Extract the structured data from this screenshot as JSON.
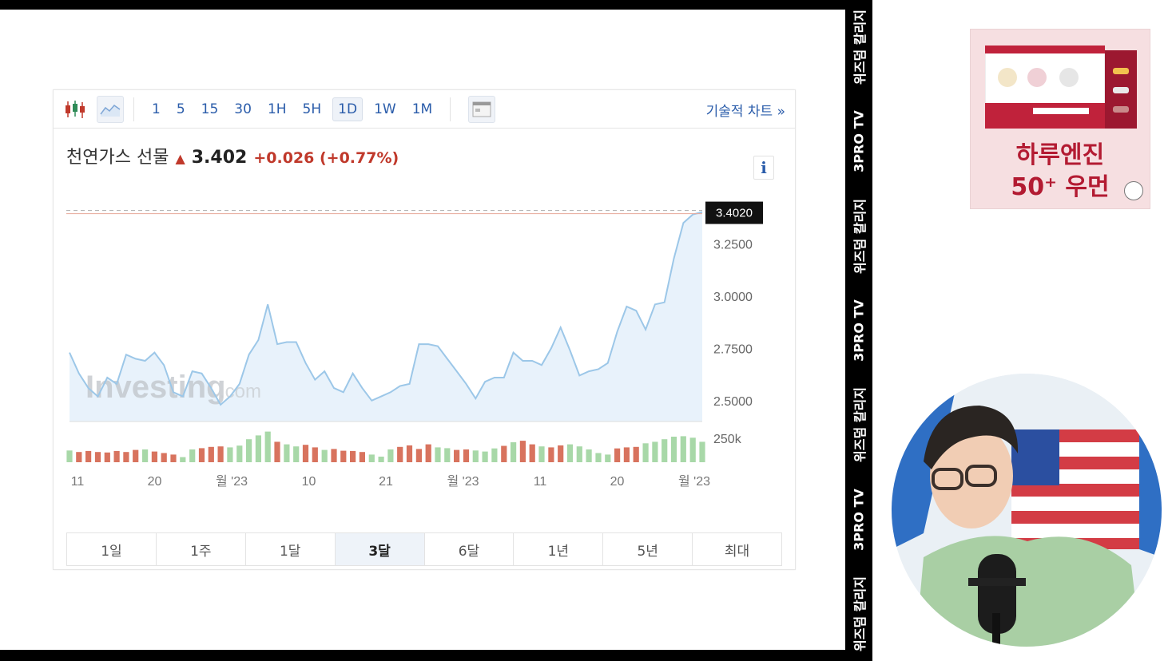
{
  "toolbar": {
    "intervals": [
      "1",
      "5",
      "15",
      "30",
      "1H",
      "5H",
      "1D",
      "1W",
      "1M"
    ],
    "selected_interval": "1D",
    "tech_chart_label": "기술적 차트 »"
  },
  "quote": {
    "name": "천연가스 선물",
    "price": "3.402",
    "change": "+0.026 (+0.77%)",
    "current_tag": "3.4020",
    "info_label": "i"
  },
  "watermark": {
    "brand": "Investing",
    "suffix": ".com"
  },
  "chart_data": {
    "type": "area",
    "ylim": [
      2.4,
      3.45
    ],
    "yticks": [
      "3.2500",
      "3.0000",
      "2.7500",
      "2.5000"
    ],
    "ytick_values": [
      3.25,
      3.0,
      2.75,
      2.5
    ],
    "current_value": 3.402,
    "xtick_labels": [
      "11",
      "20",
      "월 '23",
      "10",
      "21",
      "월 '23",
      "11",
      "20",
      "월 '23"
    ],
    "volume_label": "250k",
    "values": [
      2.73,
      2.63,
      2.56,
      2.52,
      2.61,
      2.58,
      2.72,
      2.7,
      2.69,
      2.73,
      2.67,
      2.54,
      2.52,
      2.64,
      2.63,
      2.56,
      2.48,
      2.52,
      2.58,
      2.72,
      2.79,
      2.96,
      2.77,
      2.78,
      2.78,
      2.68,
      2.6,
      2.64,
      2.56,
      2.54,
      2.63,
      2.56,
      2.5,
      2.52,
      2.54,
      2.57,
      2.58,
      2.77,
      2.77,
      2.76,
      2.7,
      2.64,
      2.58,
      2.51,
      2.59,
      2.61,
      2.61,
      2.73,
      2.69,
      2.69,
      2.67,
      2.75,
      2.85,
      2.74,
      2.62,
      2.64,
      2.65,
      2.68,
      2.83,
      2.95,
      2.93,
      2.84,
      2.96,
      2.97,
      3.18,
      3.35,
      3.39,
      3.402
    ],
    "volumes": [
      0.46,
      0.4,
      0.44,
      0.4,
      0.38,
      0.44,
      0.4,
      0.48,
      0.5,
      0.42,
      0.36,
      0.3,
      0.2,
      0.5,
      0.55,
      0.6,
      0.62,
      0.58,
      0.65,
      0.9,
      1.05,
      1.2,
      0.8,
      0.7,
      0.62,
      0.68,
      0.58,
      0.48,
      0.52,
      0.45,
      0.44,
      0.4,
      0.3,
      0.22,
      0.5,
      0.6,
      0.66,
      0.52,
      0.7,
      0.58,
      0.55,
      0.48,
      0.5,
      0.46,
      0.42,
      0.54,
      0.64,
      0.78,
      0.84,
      0.7,
      0.62,
      0.58,
      0.66,
      0.7,
      0.62,
      0.5,
      0.36,
      0.3,
      0.54,
      0.58,
      0.6,
      0.74,
      0.8,
      0.9,
      1.0,
      1.02,
      0.96,
      0.8
    ],
    "volume_up": [
      true,
      false,
      false,
      false,
      false,
      false,
      false,
      false,
      true,
      false,
      false,
      false,
      true,
      true,
      false,
      false,
      false,
      true,
      true,
      true,
      true,
      true,
      false,
      true,
      true,
      false,
      false,
      true,
      false,
      false,
      false,
      false,
      true,
      true,
      true,
      false,
      false,
      false,
      false,
      true,
      true,
      false,
      false,
      true,
      true,
      true,
      false,
      true,
      false,
      false,
      true,
      false,
      false,
      true,
      true,
      true,
      true,
      true,
      false,
      false,
      false,
      true,
      true,
      true,
      true,
      true,
      true,
      true
    ]
  },
  "ranges": {
    "items": [
      "1일",
      "1주",
      "1달",
      "3달",
      "6달",
      "1년",
      "5년",
      "최대"
    ],
    "selected": "3달"
  },
  "banner": {
    "items": [
      "위즈덤 칼리지",
      "3PRO TV",
      "위즈덤 칼리지",
      "3PRO TV",
      "위즈덤 칼리지",
      "3PRO TV",
      "위즈덤 칼리지"
    ]
  },
  "ad": {
    "line1": "하루엔진",
    "line2": "50⁺ 우먼"
  },
  "colors": {
    "link_blue": "#2a5caa",
    "up_red": "#c0392b",
    "line_blue": "#9cc7e8",
    "area_fill": "#e8f2fb",
    "vol_green": "#a8d8a8",
    "vol_red": "#d8735e",
    "ad_red": "#b31b32"
  }
}
